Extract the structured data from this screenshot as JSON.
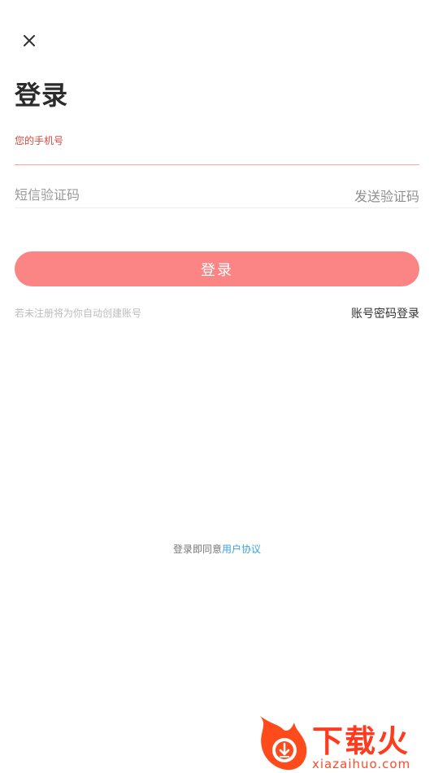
{
  "header": {
    "close_icon": "close-icon",
    "title": "登录"
  },
  "phone_field": {
    "label": "您的手机号",
    "value": ""
  },
  "sms_field": {
    "placeholder": "短信验证码",
    "send_code_label": "发送验证码"
  },
  "login_button": {
    "label": "登录",
    "color": "#fb8584"
  },
  "hint": {
    "auto_create": "若未注册将为你自动创建账号",
    "password_login": "账号密码登录"
  },
  "agreement": {
    "prefix": "登录即同意",
    "link": "用户协议",
    "link_color": "#3aa0e8"
  },
  "watermark": {
    "brand": "下载火",
    "domain": "xiazaihuo.com"
  }
}
